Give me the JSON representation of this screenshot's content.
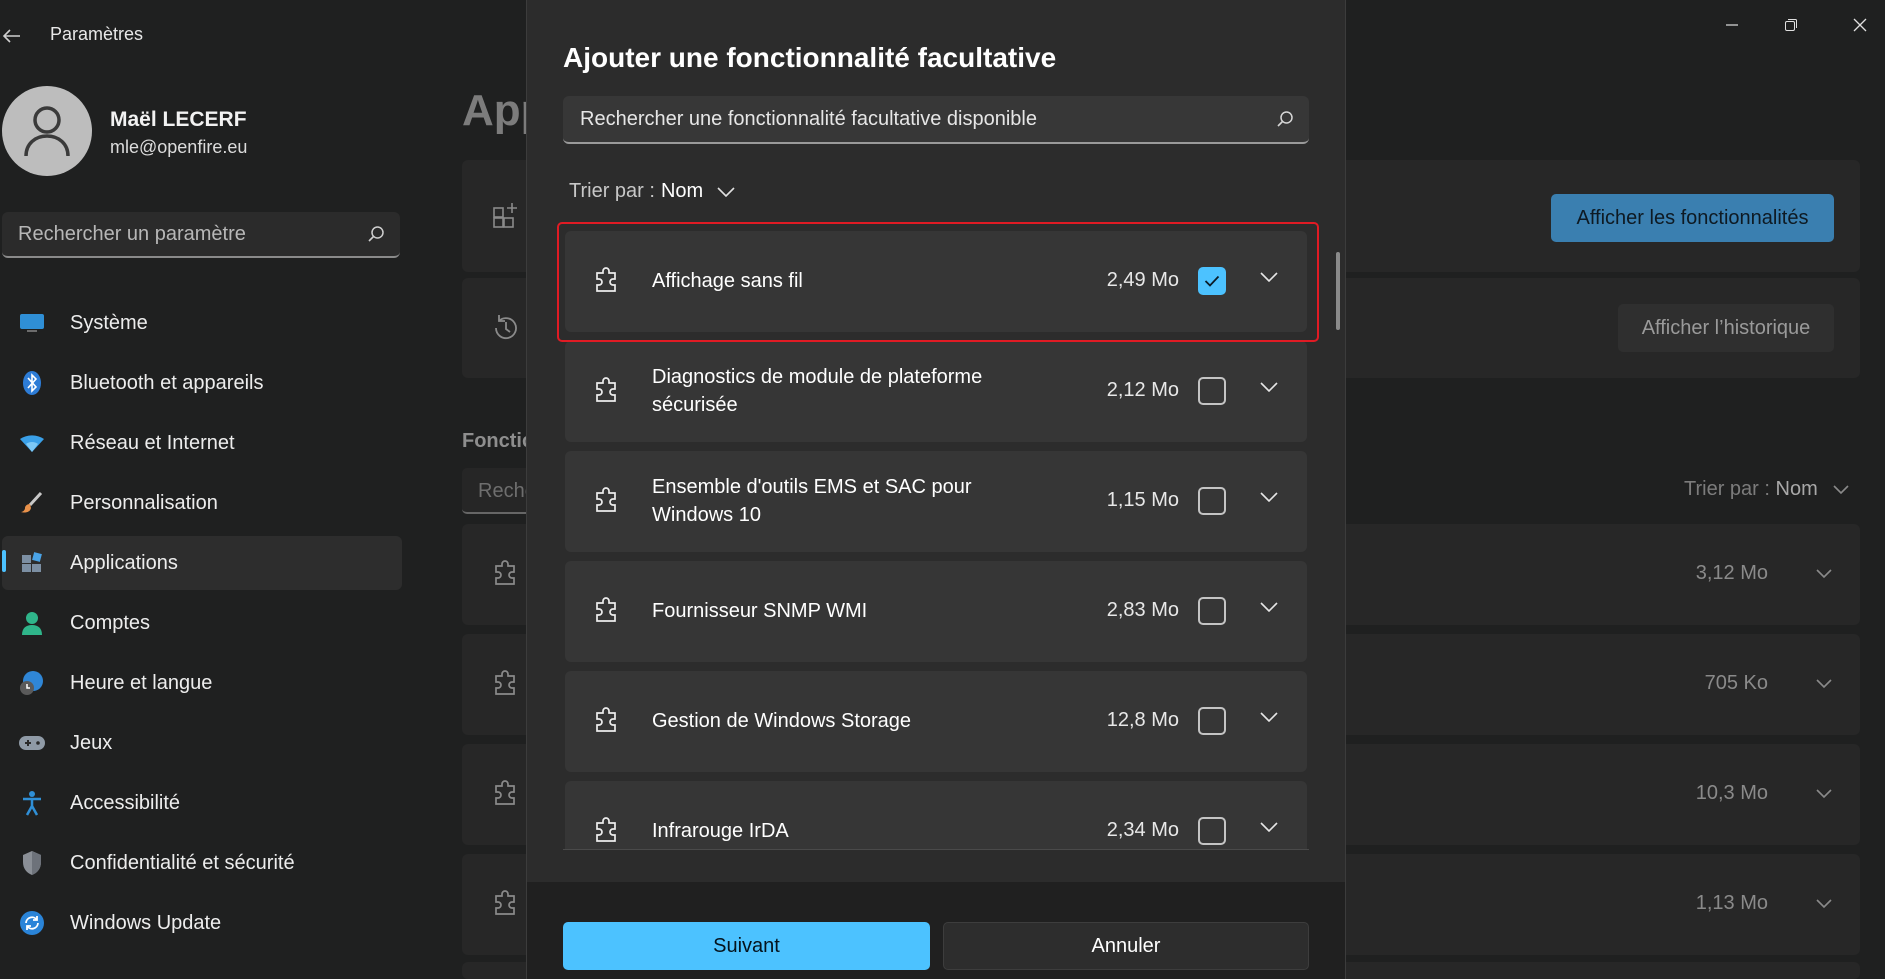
{
  "window": {
    "title": "Paramètres"
  },
  "profile": {
    "name": "Maël LECERF",
    "email": "mle@openfire.eu"
  },
  "sidebar": {
    "search_placeholder": "Rechercher un paramètre",
    "items": [
      {
        "label": "Système",
        "icon": "monitor-icon"
      },
      {
        "label": "Bluetooth et appareils",
        "icon": "bluetooth-icon"
      },
      {
        "label": "Réseau et Internet",
        "icon": "wifi-icon"
      },
      {
        "label": "Personnalisation",
        "icon": "brush-icon"
      },
      {
        "label": "Applications",
        "icon": "apps-icon",
        "selected": true
      },
      {
        "label": "Comptes",
        "icon": "person-icon"
      },
      {
        "label": "Heure et langue",
        "icon": "globe-clock-icon"
      },
      {
        "label": "Jeux",
        "icon": "gamepad-icon"
      },
      {
        "label": "Accessibilité",
        "icon": "accessibility-icon"
      },
      {
        "label": "Confidentialité et sécurité",
        "icon": "shield-icon"
      },
      {
        "label": "Windows Update",
        "icon": "update-icon"
      }
    ]
  },
  "background": {
    "page_title": "App",
    "view_features_label": "Afficher les fonctionnalités",
    "view_history_label": "Afficher l’historique",
    "section_title": "Fonctic",
    "search_placeholder": "Reche",
    "sort_label": "Trier par :",
    "sort_value": "Nom",
    "sizes": [
      "3,12 Mo",
      "705 Ko",
      "10,3 Mo",
      "1,13 Mo"
    ]
  },
  "dialog": {
    "title": "Ajouter une fonctionnalité facultative",
    "search_placeholder": "Rechercher une fonctionnalité facultative disponible",
    "sort_label": "Trier par :",
    "sort_value": "Nom",
    "features": [
      {
        "name": "Affichage sans fil",
        "size": "2,49 Mo",
        "checked": true
      },
      {
        "name": "Diagnostics de module de plateforme sécurisée",
        "size": "2,12 Mo",
        "checked": false
      },
      {
        "name": "Ensemble d'outils EMS et SAC pour Windows 10",
        "size": "1,15 Mo",
        "checked": false
      },
      {
        "name": "Fournisseur SNMP WMI",
        "size": "2,83 Mo",
        "checked": false
      },
      {
        "name": "Gestion de Windows Storage",
        "size": "12,8 Mo",
        "checked": false
      },
      {
        "name": "Infrarouge IrDA",
        "size": "2,34 Mo",
        "checked": false
      }
    ],
    "next_label": "Suivant",
    "cancel_label": "Annuler"
  },
  "colors": {
    "accent": "#4cc2ff",
    "highlight": "#e01b24",
    "background": "#1f2020",
    "dialog": "#2c2c2c"
  }
}
